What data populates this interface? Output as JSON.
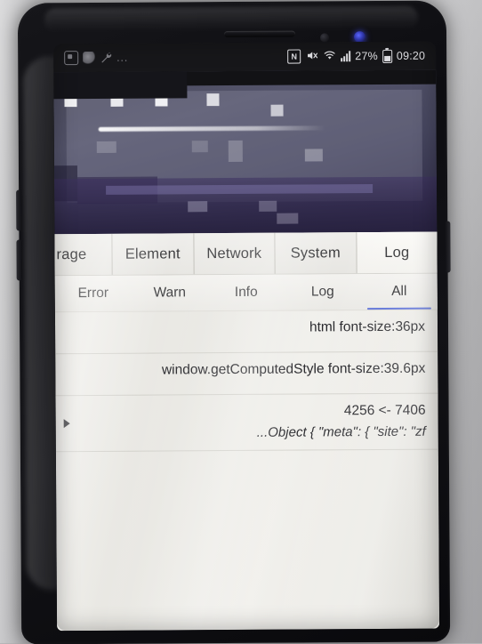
{
  "device": {
    "type": "android-phone",
    "frame_color": "#121216",
    "accent_color": "#5a6fd6"
  },
  "status_bar": {
    "notification_icons": [
      "app-badge-icon",
      "app-blob-icon",
      "wrench-icon"
    ],
    "overflow": "...",
    "nfc_label": "N",
    "icons": [
      "nfc-icon",
      "mute-icon",
      "wifi-icon",
      "signal-icon",
      "battery-icon"
    ],
    "battery_percent": "27%",
    "time": "09:20"
  },
  "censored_region": {
    "label": "mosaic-censored-webview",
    "note": "pixelated/redacted page content"
  },
  "devtools": {
    "main_tabs": [
      {
        "label": "rage",
        "active": false,
        "clipped": true
      },
      {
        "label": "Element",
        "active": false
      },
      {
        "label": "Network",
        "active": false
      },
      {
        "label": "System",
        "active": false
      },
      {
        "label": "Log",
        "active": true
      }
    ],
    "filter_tabs": [
      {
        "label": "Error",
        "active": false
      },
      {
        "label": "Warn",
        "active": false
      },
      {
        "label": "Info",
        "active": false
      },
      {
        "label": "Log",
        "active": false
      },
      {
        "label": "All",
        "active": true
      }
    ],
    "log_entries": [
      {
        "text": "html font-size:36px",
        "expandable": false,
        "detail": ""
      },
      {
        "text": "window.getComputedStyle font-size:39.6px",
        "expandable": false,
        "detail": ""
      },
      {
        "text": "4256 <- 7406",
        "expandable": true,
        "detail": "...Object { \"meta\": { \"site\": \"zf"
      }
    ]
  }
}
